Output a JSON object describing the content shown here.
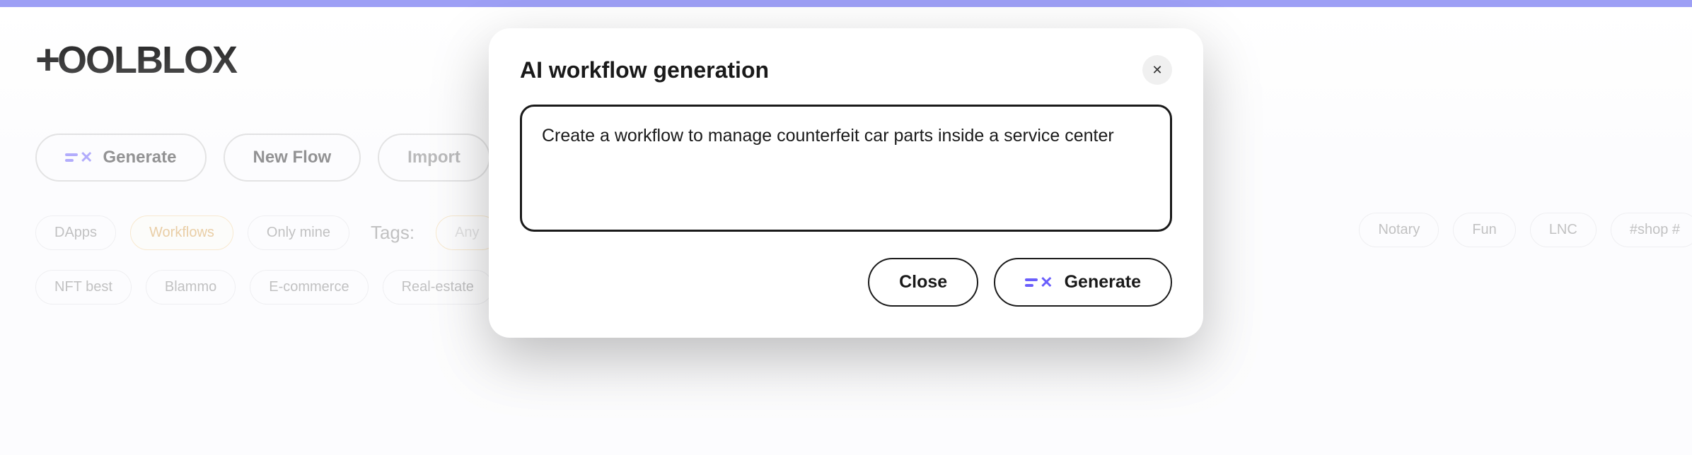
{
  "brand": {
    "name": "+OOLBLOX"
  },
  "toolbar": {
    "generate_label": "Generate",
    "new_flow_label": "New Flow",
    "import_label": "Import"
  },
  "filters": {
    "dapps": "DApps",
    "workflows": "Workflows",
    "only_mine": "Only mine",
    "tags_label": "Tags:",
    "any": "Any",
    "row2": {
      "nft_best": "NFT best",
      "blammo": "Blammo",
      "ecommerce": "E-commerce",
      "real_estate": "Real-estate"
    },
    "right": {
      "notary": "Notary",
      "fun": "Fun",
      "lnc": "LNC",
      "shop": "#shop #"
    }
  },
  "modal": {
    "title": "AI workflow generation",
    "textarea_value": "Create a workflow to manage counterfeit car parts inside a service center",
    "close_label": "Close",
    "generate_label": "Generate"
  },
  "colors": {
    "accent": "#6a5efc"
  }
}
